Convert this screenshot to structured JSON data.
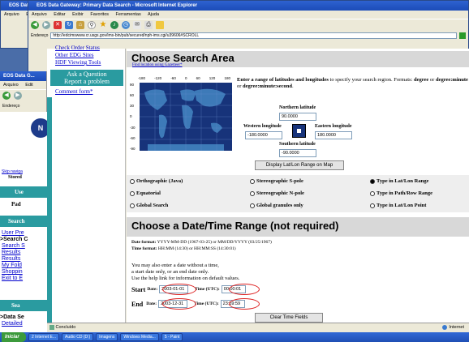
{
  "back_windows": [
    {
      "title": "EOS Data G..."
    },
    {
      "title": "EOS Data Gateway: Primary Data Search - Microsoft Internet Explorer"
    }
  ],
  "window": {
    "title": "EOS Data Gateway: Primary Data Search - Microsoft Internet Explorer",
    "menu": [
      "Arquivo",
      "Editar",
      "Exibir",
      "Favoritos",
      "Ferramentas",
      "Ajuda"
    ],
    "back_menu": [
      "Arquivo",
      "Edit"
    ],
    "address_label": "Endereço",
    "url": "http://edcimswww.cr.usgs.gov/ims-bin/pub/secured/nph-ims.cgi/u39606#SCROLL",
    "status": "Concluído",
    "zone": "Internet"
  },
  "sidebar": {
    "links_top": [
      "Check Order Status",
      "Other EDG Sites",
      "HDF Viewing Tools"
    ],
    "ask_box": [
      "Ask a Question",
      "Report a problem"
    ],
    "comment_link": "Comment form*",
    "partial_items": [
      "Skip naviga",
      "Stored",
      "Use",
      "Pad",
      "Search",
      "User Pre",
      ">Search C",
      "Search S",
      "Results",
      "Results",
      "My Fold",
      "Shoppin",
      "Exit to E",
      "Sea",
      ">Data Se",
      "Detailed"
    ]
  },
  "search_area": {
    "heading": "Choose Search Area",
    "find_link": "Find location using Gazetteer*",
    "instructions_bold": "Enter a range of latitudes and longitudes",
    "instructions_1": " to specify your search region. Formats: ",
    "instructions_fmt1": "degree",
    "instructions_2": " or ",
    "instructions_fmt2": "degree:minute",
    "instructions_3": " or ",
    "instructions_fmt3": "degree:minute:second",
    "instructions_4": ".",
    "map_top_ticks": [
      "-180",
      "-120",
      "-60",
      "0",
      "60",
      "120",
      "180"
    ],
    "map_left_ticks": [
      "90",
      "60",
      "30",
      "0",
      "-30",
      "-60",
      "-90"
    ],
    "north_label": "Northern latitude",
    "north_value": "90.0000",
    "west_label": "Western longitude",
    "west_value": "-180.0000",
    "east_label": "Eastern longitude",
    "east_value": "180.0000",
    "south_label": "Southern latitude",
    "south_value": "-90.0000",
    "display_button": "Display Lat/Lon Range on Map",
    "options": [
      {
        "label": "Orthographic (Java)",
        "selected": false
      },
      {
        "label": "Stereographic S-pole",
        "selected": false
      },
      {
        "label": "Type in Lat/Lon Range",
        "selected": true
      },
      {
        "label": "Equatorial",
        "selected": false
      },
      {
        "label": "Stereographic N-pole",
        "selected": false
      },
      {
        "label": "Type in Path/Row Range",
        "selected": false
      },
      {
        "label": "Global Search",
        "selected": false
      },
      {
        "label": "Global granules only",
        "selected": false
      },
      {
        "label": "Type in Lat/Lon Point",
        "selected": false
      }
    ]
  },
  "date_range": {
    "heading": "Choose a Date/Time Range (not required)",
    "date_format_label": "Date format:",
    "date_format_value": "YYYY-MM-DD (1967-03-25) or MM/DD/YYYY (03/25/1967)",
    "time_format_label": "Time format:",
    "time_format_value": "HH:MM (14:30) or HH:MM:SS (14:30:01)",
    "help_lines": [
      "You may also enter a date without a time,",
      "a start date only, or an end date only.",
      "Use the help link for information on default values."
    ],
    "start_label": "Start",
    "end_label": "End",
    "date_label": "Date:",
    "time_label": "Time (UTC):",
    "start_date": "2003-01-01",
    "start_time": "00:00:01",
    "end_date": "2003-12-31",
    "end_time": "23:59:59",
    "clear_button": "Clear Time Fields"
  },
  "taskbar": {
    "start": "Iniciar",
    "tasks": [
      "2 Internet E...",
      "Audio CD (D:)",
      "Imagens",
      "Windows Media...",
      "5 - Paint"
    ]
  }
}
